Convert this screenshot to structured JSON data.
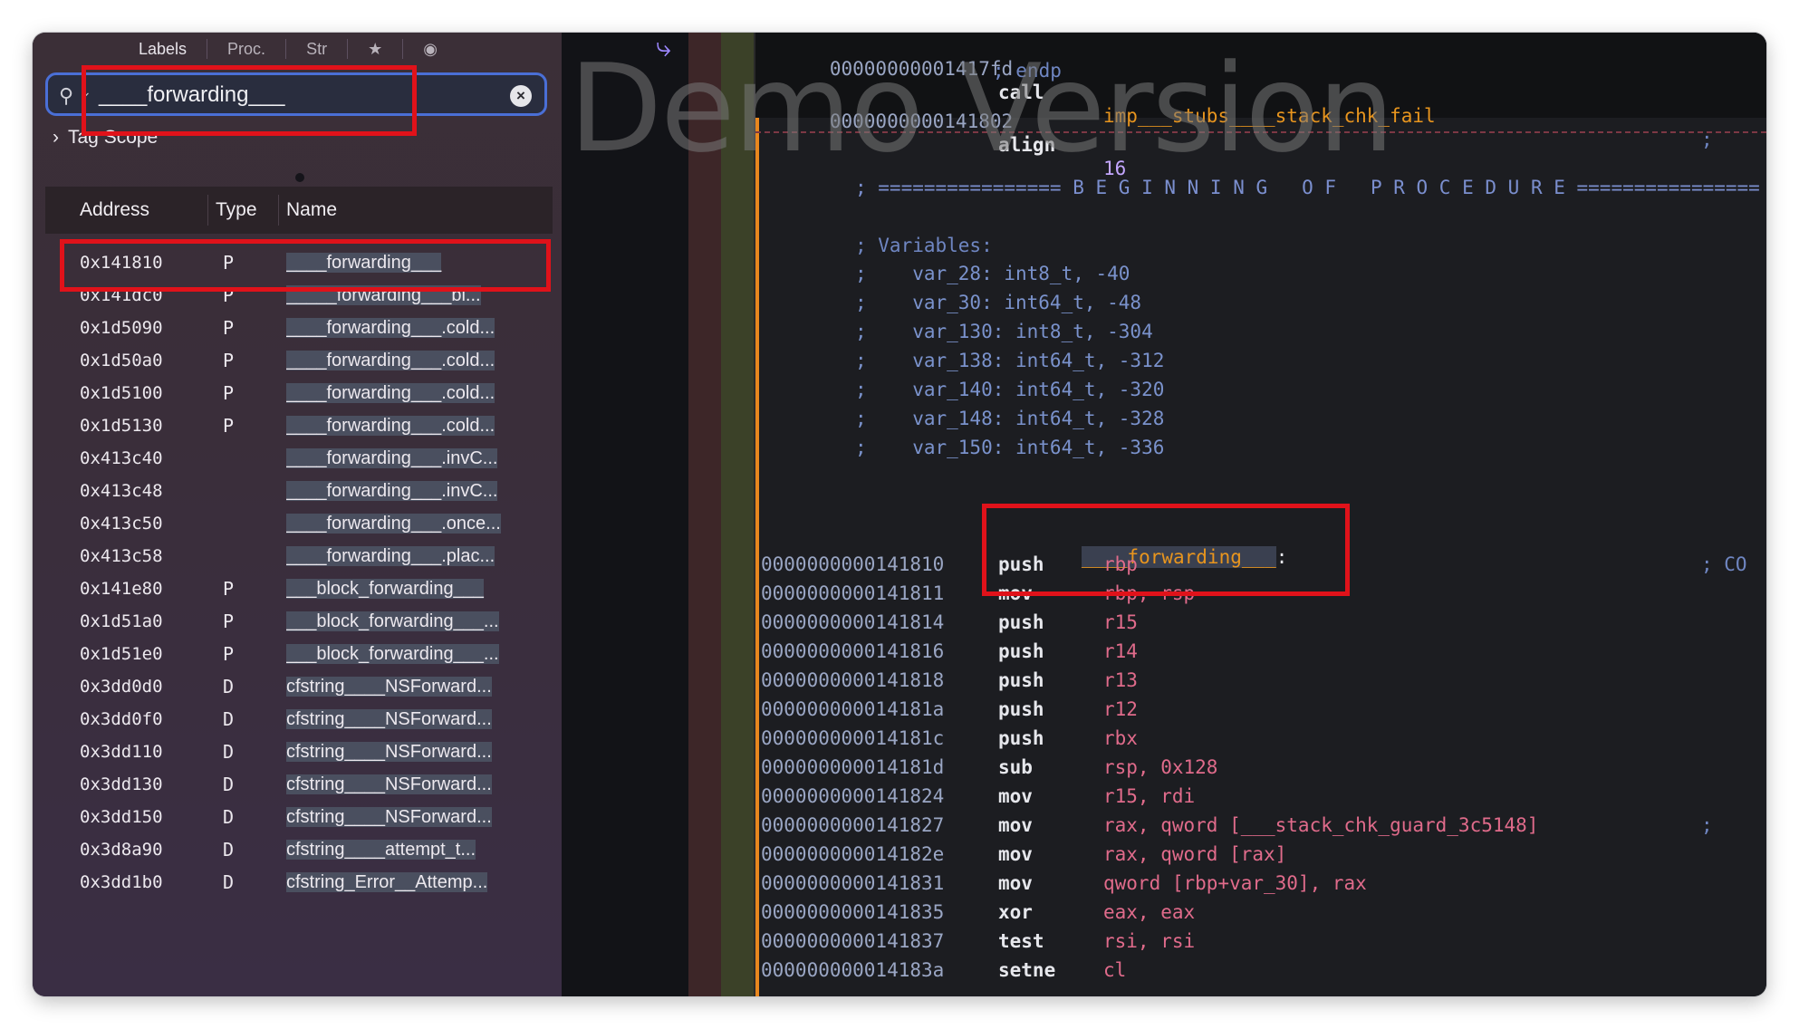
{
  "watermark": "Demo Version",
  "sidebar": {
    "tabs": [
      "Labels",
      "Proc.",
      "Str",
      "★",
      "◉"
    ],
    "search": {
      "value": "____forwarding___"
    },
    "tag_scope": "Tag Scope",
    "columns": {
      "address": "Address",
      "type": "Type",
      "name": "Name"
    },
    "rows": [
      {
        "address": "0x141810",
        "type": "P",
        "name": "____forwarding___"
      },
      {
        "address": "0x141dc0",
        "type": "P",
        "name": "_____forwarding___bl..."
      },
      {
        "address": "0x1d5090",
        "type": "P",
        "name": "____forwarding___.cold..."
      },
      {
        "address": "0x1d50a0",
        "type": "P",
        "name": "____forwarding___.cold..."
      },
      {
        "address": "0x1d5100",
        "type": "P",
        "name": "____forwarding___.cold..."
      },
      {
        "address": "0x1d5130",
        "type": "P",
        "name": "____forwarding___.cold..."
      },
      {
        "address": "0x413c40",
        "type": "",
        "name": "____forwarding___.invC..."
      },
      {
        "address": "0x413c48",
        "type": "",
        "name": "____forwarding___.invC..."
      },
      {
        "address": "0x413c50",
        "type": "",
        "name": "____forwarding___.once..."
      },
      {
        "address": "0x413c58",
        "type": "",
        "name": "____forwarding___.plac..."
      },
      {
        "address": "0x141e80",
        "type": "P",
        "name": "___block_forwarding___"
      },
      {
        "address": "0x1d51a0",
        "type": "P",
        "name": "___block_forwarding___..."
      },
      {
        "address": "0x1d51e0",
        "type": "P",
        "name": "___block_forwarding___..."
      },
      {
        "address": "0x3dd0d0",
        "type": "D",
        "name": "cfstring____NSForward..."
      },
      {
        "address": "0x3dd0f0",
        "type": "D",
        "name": "cfstring____NSForward..."
      },
      {
        "address": "0x3dd110",
        "type": "D",
        "name": "cfstring____NSForward..."
      },
      {
        "address": "0x3dd130",
        "type": "D",
        "name": "cfstring____NSForward..."
      },
      {
        "address": "0x3dd150",
        "type": "D",
        "name": "cfstring____NSForward..."
      },
      {
        "address": "0x3d8a90",
        "type": "D",
        "name": "cfstring____attempt_t..."
      },
      {
        "address": "0x3dd1b0",
        "type": "D",
        "name": "cfstring_Error__Attemp..."
      }
    ]
  },
  "code": {
    "top": [
      {
        "addr": "00000000001417fd",
        "mnem": "call",
        "op": "imp___stubs____stack_chk_fail",
        "tail": ";"
      },
      {
        "comment": "; endp"
      },
      {
        "addr": "0000000000141802",
        "mnem": "align",
        "op": "16"
      }
    ],
    "banner": "; ================ B E G I N N I N G   O F   P R O C E D U R E ================",
    "variables_header": "; Variables:",
    "variables": [
      ";    var_28: int8_t, -40",
      ";    var_30: int64_t, -48",
      ";    var_130: int8_t, -304",
      ";    var_138: int64_t, -312",
      ";    var_140: int64_t, -320",
      ";    var_148: int64_t, -328",
      ";    var_150: int64_t, -336"
    ],
    "label": "____forwarding___",
    "label_suffix": ":",
    "instructions": [
      {
        "addr": "0000000000141810",
        "mnem": "push",
        "op": "rbp",
        "tail": "; CO"
      },
      {
        "addr": "0000000000141811",
        "mnem": "mov",
        "op": "rbp, rsp"
      },
      {
        "addr": "0000000000141814",
        "mnem": "push",
        "op": "r15"
      },
      {
        "addr": "0000000000141816",
        "mnem": "push",
        "op": "r14"
      },
      {
        "addr": "0000000000141818",
        "mnem": "push",
        "op": "r13"
      },
      {
        "addr": "000000000014181a",
        "mnem": "push",
        "op": "r12"
      },
      {
        "addr": "000000000014181c",
        "mnem": "push",
        "op": "rbx"
      },
      {
        "addr": "000000000014181d",
        "mnem": "sub",
        "op": "rsp, 0x128"
      },
      {
        "addr": "0000000000141824",
        "mnem": "mov",
        "op": "r15, rdi"
      },
      {
        "addr": "0000000000141827",
        "mnem": "mov",
        "op": "rax, qword [___stack_chk_guard_3c5148]",
        "tail": ";"
      },
      {
        "addr": "000000000014182e",
        "mnem": "mov",
        "op": "rax, qword [rax]"
      },
      {
        "addr": "0000000000141831",
        "mnem": "mov",
        "op": "qword [rbp+var_30], rax"
      },
      {
        "addr": "0000000000141835",
        "mnem": "xor",
        "op": "eax, eax"
      },
      {
        "addr": "0000000000141837",
        "mnem": "test",
        "op": "rsi, rsi"
      },
      {
        "addr": "000000000014183a",
        "mnem": "setne",
        "op": "cl"
      }
    ]
  }
}
